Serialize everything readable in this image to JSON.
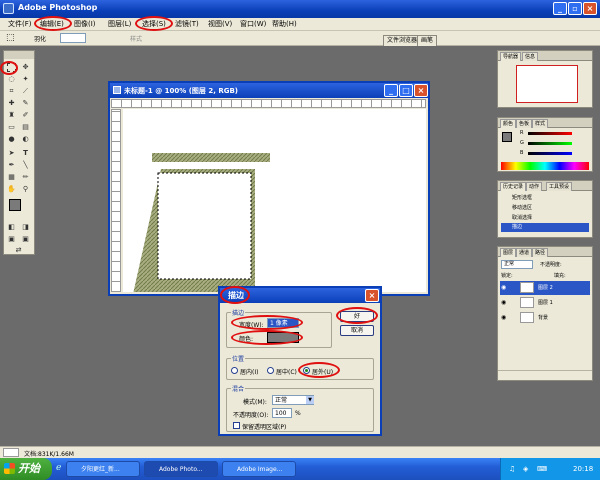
{
  "app": {
    "title": "Adobe Photoshop"
  },
  "menubar": {
    "items": [
      "文件(F)",
      "编辑(E)",
      "图像(I)",
      "图层(L)",
      "选择(S)",
      "滤镜(T)",
      "视图(V)",
      "窗口(W)",
      "帮助(H)"
    ]
  },
  "options": {
    "feather_label": "羽化",
    "feather_value": "",
    "style_label": "样式",
    "browser_tabs": [
      "文件浏览器",
      "画笔"
    ]
  },
  "document": {
    "title": "未标题-1 @ 100% (图层 2, RGB)"
  },
  "dialog": {
    "title": "描边",
    "stroke_group": "描边",
    "width_label": "宽度(W):",
    "width_value": "1 像素",
    "color_label": "颜色:",
    "color": "#7a7a7a",
    "ok": "好",
    "cancel": "取消",
    "location_group": "位置",
    "inside": "居内(I)",
    "center": "居中(C)",
    "outside": "居外(U)",
    "blend_group": "混合",
    "mode_label": "模式(M):",
    "mode_value": "正常",
    "opacity_label": "不透明度(O):",
    "opacity_value": "100",
    "opacity_unit": "%",
    "preserve_label": "保留透明区域(P)"
  },
  "palettes": {
    "navigator_tabs": [
      "导航器",
      "信息"
    ],
    "color_tabs": [
      "颜色",
      "色板",
      "样式"
    ],
    "color_channels": [
      "R",
      "G",
      "B"
    ],
    "history_tabs": [
      "历史记录",
      "动作",
      "工具预设"
    ],
    "history_items": [
      "矩形选框",
      "移动选区",
      "取消选择",
      "描边"
    ],
    "layers_tabs": [
      "图层",
      "通道",
      "路径"
    ],
    "layers_blend": "正常",
    "layers_opacity_label": "不透明度:",
    "layers_lock_label": "锁定:",
    "layers_fill_label": "填充:",
    "layers": [
      "图层 2",
      "图层 1",
      "背景"
    ]
  },
  "status": {
    "doc_info": "文档:831K/1.66M"
  },
  "taskbar": {
    "start": "开始",
    "tasks": [
      "夕阳更红_新...",
      "Adobe Photo...",
      "Adobe Image..."
    ],
    "time": "20:18"
  },
  "highlight_color": "#e01010"
}
